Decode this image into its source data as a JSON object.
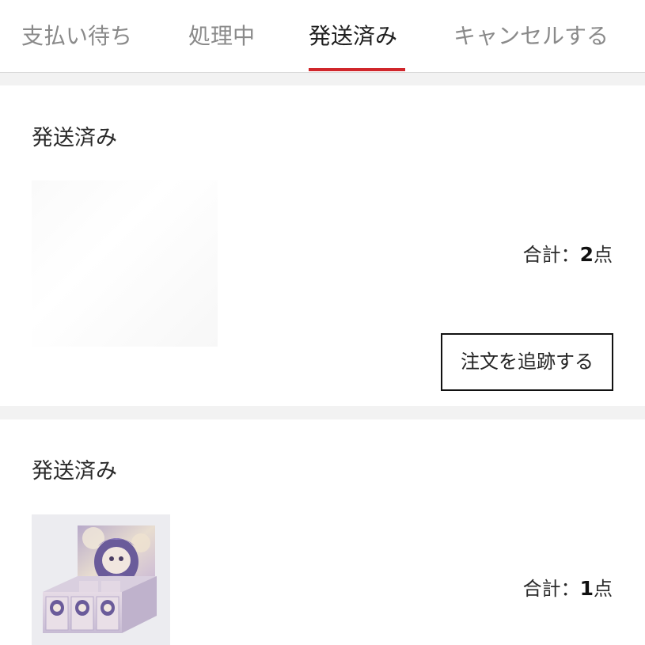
{
  "tabs": [
    {
      "label": "支払い待ち"
    },
    {
      "label": "処理中"
    },
    {
      "label": "発送済み"
    },
    {
      "label": "キャンセルする"
    }
  ],
  "active_tab": "発送済み",
  "colors": {
    "accent": "#d0262b",
    "inactive_tab": "#8a8a8a"
  },
  "orders": [
    {
      "status": "発送済み",
      "total_prefix": "合計：",
      "total_count": "2",
      "total_suffix": "点",
      "track_label": "注文を追跡する"
    },
    {
      "status": "発送済み",
      "total_prefix": "合計：",
      "total_count": "1",
      "total_suffix": "点",
      "image": "blind-box-figure-product-image"
    }
  ]
}
